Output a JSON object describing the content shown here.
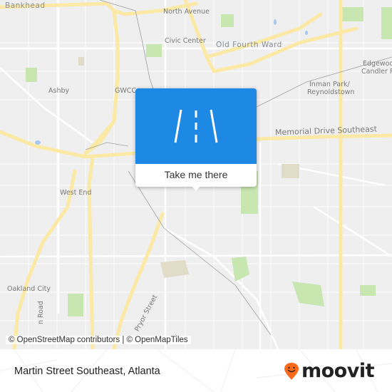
{
  "map": {
    "labels": {
      "bankhead": "Bankhead",
      "north_avenue": "North Avenue",
      "civic_center": "Civic Center",
      "old_fourth_ward": "Old Fourth Ward",
      "edgewood": "Edgewood",
      "candler_park": "Candler Park",
      "ashby": "Ashby",
      "gwcc": "GWCC",
      "inman_park": "Inman Park/",
      "reynoldstown": "Reynoldstown",
      "memorial_drive": "Memorial Drive Southeast",
      "west_end": "West End",
      "oakland_city": "Oakland City",
      "road_vertical": "n Road",
      "pryor_street": "Pryor Street"
    },
    "attribution": "© OpenStreetMap contributors | © OpenMapTiles"
  },
  "popup": {
    "icon": "road-icon",
    "action_label": "Take me there"
  },
  "footer": {
    "address": "Martin Street Southeast, Atlanta",
    "brand": "moovit",
    "brand_color": "#ff6a1a",
    "accent_color": "#1e88e5"
  }
}
